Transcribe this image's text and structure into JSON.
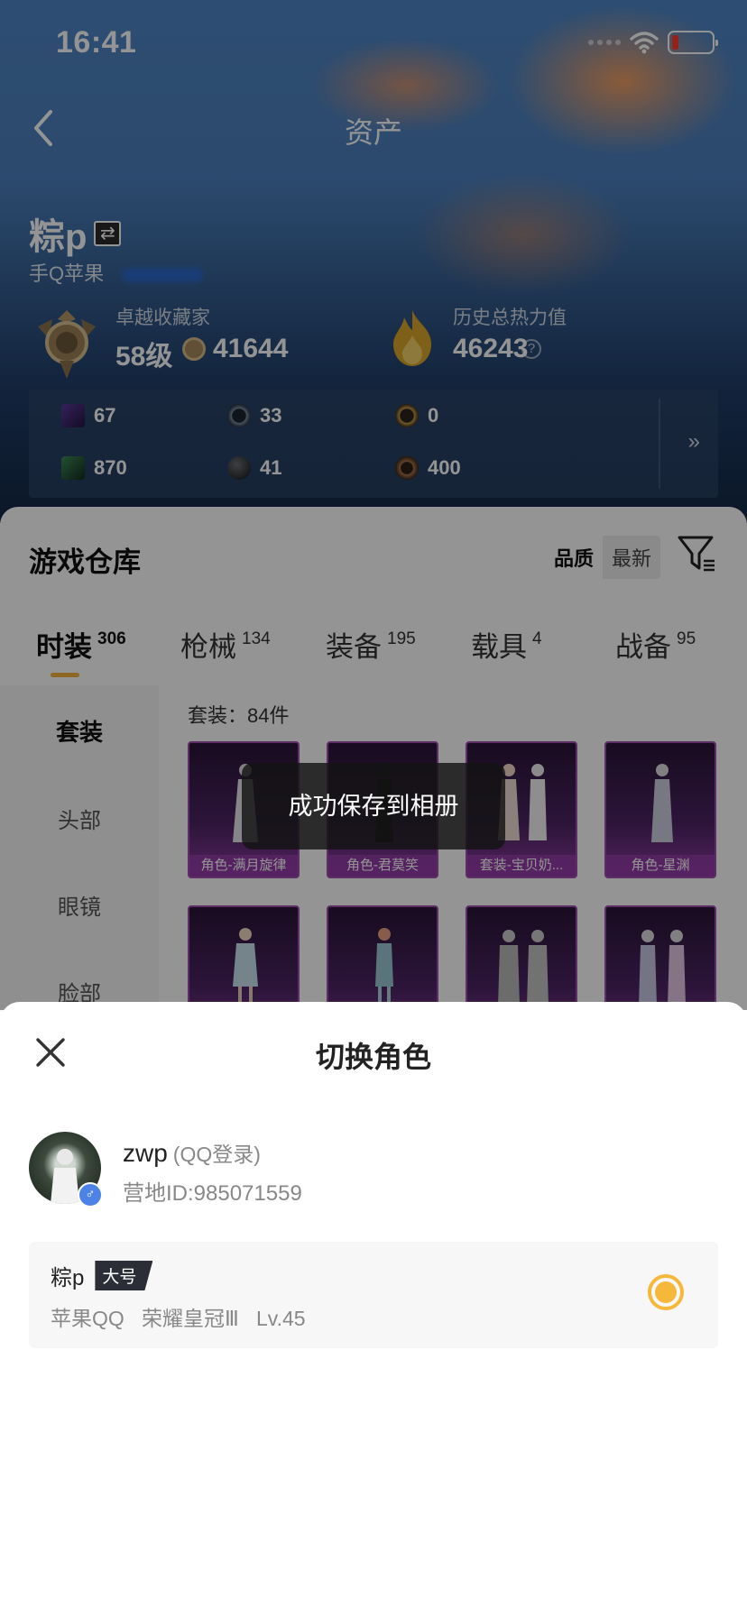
{
  "status_bar": {
    "time": "16:41"
  },
  "header": {
    "title": "资产"
  },
  "profile": {
    "name": "粽p",
    "platform": "手Q苹果",
    "collector_label": "卓越收藏家",
    "collector_level": "58级",
    "collector_points": "41644",
    "heat_label": "历史总热力值",
    "heat_value": "46243",
    "heat_help": "?"
  },
  "resources": [
    {
      "icon": "purple-card-icon",
      "value": "67"
    },
    {
      "icon": "blue-coin-icon",
      "value": "33"
    },
    {
      "icon": "gold-coin-icon",
      "value": "0"
    },
    {
      "icon": "green-card-icon",
      "value": "870"
    },
    {
      "icon": "dark-orb-icon",
      "value": "41"
    },
    {
      "icon": "bronze-coin-icon",
      "value": "400"
    }
  ],
  "warehouse": {
    "title": "游戏仓库",
    "sort_quality": "品质",
    "sort_newest": "最新",
    "tabs": [
      {
        "label": "时装",
        "count": "306"
      },
      {
        "label": "枪械",
        "count": "134"
      },
      {
        "label": "装备",
        "count": "195"
      },
      {
        "label": "载具",
        "count": "4"
      },
      {
        "label": "战备",
        "count": "95"
      }
    ],
    "side_items": [
      "套装",
      "头部",
      "眼镜",
      "脸部"
    ],
    "suit_count": "套装：84件",
    "cards": [
      {
        "caption": "角色-满月旋律"
      },
      {
        "caption": "角色-君莫笑"
      },
      {
        "caption": "套装-宝贝奶..."
      },
      {
        "caption": "角色-星渊"
      },
      {
        "caption": ""
      },
      {
        "caption": ""
      },
      {
        "caption": ""
      },
      {
        "caption": ""
      }
    ]
  },
  "toast": "成功保存到相册",
  "sheet": {
    "title": "切换角色",
    "account_name": "zwp",
    "account_login": "(QQ登录)",
    "account_id": "营地ID:985071559",
    "role": {
      "name": "粽p",
      "tag": "大号",
      "sub": "苹果QQ   荣耀皇冠Ⅲ   Lv.45"
    }
  },
  "colors": {
    "accent": "#f6b83a",
    "tag_bg": "#2b2e36",
    "gender_badge": "#4d82e6"
  }
}
